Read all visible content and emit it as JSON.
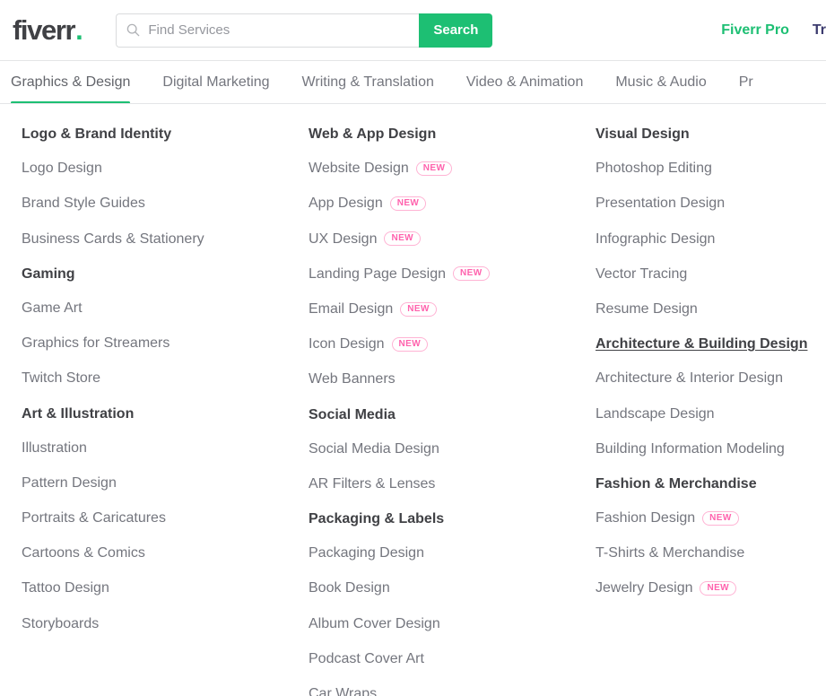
{
  "header": {
    "logo_text": "fiverr",
    "logo_dot": ".",
    "search": {
      "placeholder": "Find Services",
      "value": "",
      "button_label": "Search",
      "icon": "search-icon"
    },
    "links": [
      {
        "label": "Fiverr Pro",
        "color": "#1dbf73"
      },
      {
        "label": "Try P",
        "color": "#3c3b6e"
      }
    ]
  },
  "category_nav": {
    "active_index": 0,
    "items": [
      {
        "label": "Graphics & Design"
      },
      {
        "label": "Digital Marketing"
      },
      {
        "label": "Writing & Translation"
      },
      {
        "label": "Video & Animation"
      },
      {
        "label": "Music & Audio"
      },
      {
        "label": "Pr"
      }
    ]
  },
  "mega_menu": {
    "columns": [
      {
        "groups": [
          {
            "title": "Logo & Brand Identity",
            "underlined": false,
            "links": [
              {
                "label": "Logo Design",
                "badge": null
              },
              {
                "label": "Brand Style Guides",
                "badge": null
              },
              {
                "label": "Business Cards & Stationery",
                "badge": null
              }
            ]
          },
          {
            "title": "Gaming",
            "underlined": false,
            "links": [
              {
                "label": "Game Art",
                "badge": null
              },
              {
                "label": "Graphics for Streamers",
                "badge": null
              },
              {
                "label": "Twitch Store",
                "badge": null
              }
            ]
          },
          {
            "title": "Art & Illustration",
            "underlined": false,
            "links": [
              {
                "label": "Illustration",
                "badge": null
              },
              {
                "label": "Pattern Design",
                "badge": null
              },
              {
                "label": "Portraits & Caricatures",
                "badge": null
              },
              {
                "label": "Cartoons & Comics",
                "badge": null
              },
              {
                "label": "Tattoo Design",
                "badge": null
              },
              {
                "label": "Storyboards",
                "badge": null
              }
            ]
          }
        ]
      },
      {
        "groups": [
          {
            "title": "Web & App Design",
            "underlined": false,
            "links": [
              {
                "label": "Website Design",
                "badge": "NEW"
              },
              {
                "label": "App Design",
                "badge": "NEW"
              },
              {
                "label": "UX Design",
                "badge": "NEW"
              },
              {
                "label": "Landing Page Design",
                "badge": "NEW"
              },
              {
                "label": "Email Design",
                "badge": "NEW"
              },
              {
                "label": "Icon Design",
                "badge": "NEW"
              },
              {
                "label": "Web Banners",
                "badge": null
              }
            ]
          },
          {
            "title": "Social Media",
            "underlined": false,
            "links": [
              {
                "label": "Social Media Design",
                "badge": null
              },
              {
                "label": "AR Filters & Lenses",
                "badge": null
              }
            ]
          },
          {
            "title": "Packaging & Labels",
            "underlined": false,
            "links": [
              {
                "label": "Packaging Design",
                "badge": null
              },
              {
                "label": "Book Design",
                "badge": null
              },
              {
                "label": "Album Cover Design",
                "badge": null
              },
              {
                "label": "Podcast Cover Art",
                "badge": null
              },
              {
                "label": "Car Wraps",
                "badge": null
              }
            ]
          }
        ]
      },
      {
        "groups": [
          {
            "title": "Visual Design",
            "underlined": false,
            "links": [
              {
                "label": "Photoshop Editing",
                "badge": null
              },
              {
                "label": "Presentation Design",
                "badge": null
              },
              {
                "label": "Infographic Design",
                "badge": null
              },
              {
                "label": "Vector Tracing",
                "badge": null
              },
              {
                "label": "Resume Design",
                "badge": null
              }
            ]
          },
          {
            "title": "Architecture & Building Design",
            "underlined": true,
            "links": [
              {
                "label": "Architecture & Interior Design",
                "badge": null
              },
              {
                "label": "Landscape Design",
                "badge": null
              },
              {
                "label": "Building Information Modeling",
                "badge": null
              }
            ]
          },
          {
            "title": "Fashion & Merchandise",
            "underlined": false,
            "links": [
              {
                "label": "Fashion Design",
                "badge": "NEW"
              },
              {
                "label": "T-Shirts & Merchandise",
                "badge": null
              },
              {
                "label": "Jewelry Design",
                "badge": "NEW"
              }
            ]
          }
        ]
      }
    ]
  },
  "colors": {
    "brand_green": "#1dbf73",
    "badge_pink": "#ff62ad",
    "text_dark": "#404145",
    "text_gray": "#74767e",
    "pro_navy": "#3c3b6e"
  }
}
